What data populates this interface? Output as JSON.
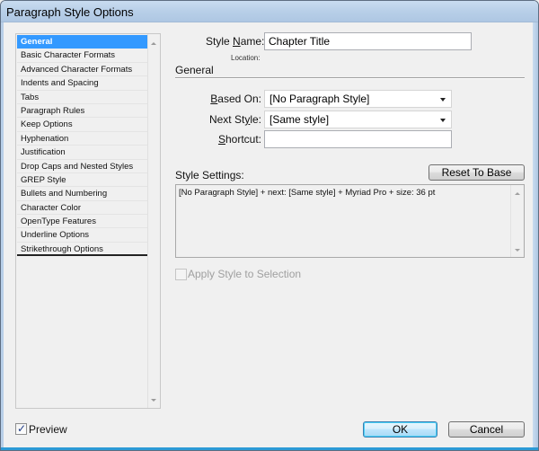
{
  "window": {
    "title": "Paragraph Style Options"
  },
  "categories": {
    "selected_index": 0,
    "items": [
      {
        "label": "General"
      },
      {
        "label": "Basic Character Formats"
      },
      {
        "label": "Advanced Character Formats"
      },
      {
        "label": "Indents and Spacing"
      },
      {
        "label": "Tabs"
      },
      {
        "label": "Paragraph Rules"
      },
      {
        "label": "Keep Options"
      },
      {
        "label": "Hyphenation"
      },
      {
        "label": "Justification"
      },
      {
        "label": "Drop Caps and Nested Styles"
      },
      {
        "label": "GREP Style"
      },
      {
        "label": "Bullets and Numbering"
      },
      {
        "label": "Character Color"
      },
      {
        "label": "OpenType Features"
      },
      {
        "label": "Underline Options"
      },
      {
        "label": "Strikethrough Options"
      }
    ]
  },
  "style_name": {
    "label_pre": "Style ",
    "label_mnemonic": "N",
    "label_post": "ame:",
    "value": "Chapter Title"
  },
  "location": {
    "label": "Location:"
  },
  "section": {
    "title": "General"
  },
  "based_on": {
    "label_mnemonic": "B",
    "label_post": "ased On:",
    "value": "[No Paragraph Style]"
  },
  "next_style": {
    "label_pre": "Next St",
    "label_mnemonic": "y",
    "label_post": "le:",
    "value": "[Same style]"
  },
  "shortcut": {
    "label_mnemonic": "S",
    "label_post": "hortcut:",
    "value": ""
  },
  "style_settings": {
    "label": "Style Settings:",
    "reset_button": "Reset To Base",
    "text": "[No Paragraph Style] + next: [Same style] + Myriad Pro + size: 36 pt"
  },
  "apply_style": {
    "label": "Apply Style to Selection",
    "checked": false,
    "enabled": false
  },
  "preview": {
    "label": "Preview",
    "checked": true
  },
  "buttons": {
    "ok": "OK",
    "cancel": "Cancel"
  }
}
